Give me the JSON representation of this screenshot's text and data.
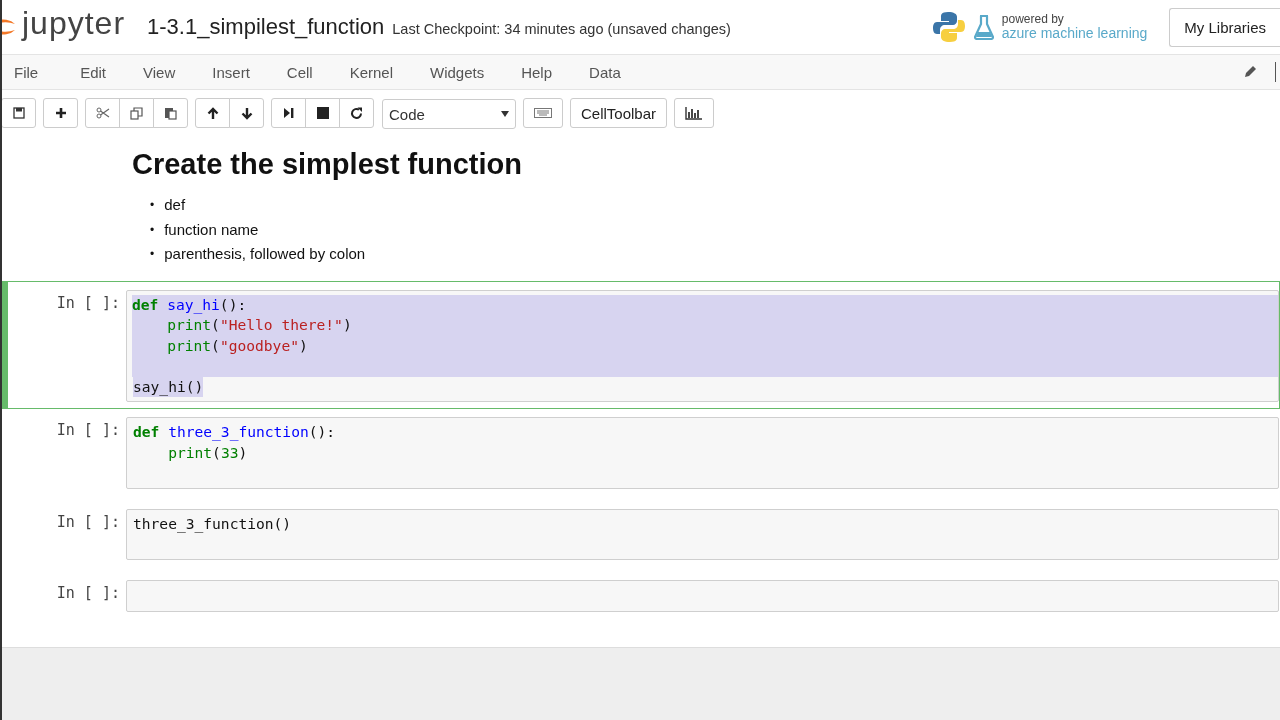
{
  "header": {
    "logo_text": "jupyter",
    "notebook_name": "1-3.1_simpilest_function",
    "checkpoint": "Last Checkpoint: 34 minutes ago (unsaved changes)",
    "powered_by": "powered by",
    "azure": "azure machine learning",
    "libraries_button": "My Libraries"
  },
  "menu": [
    "File",
    "Edit",
    "View",
    "Insert",
    "Cell",
    "Kernel",
    "Widgets",
    "Help",
    "Data"
  ],
  "toolbar": {
    "cell_type": "Code",
    "celltoolbar_button": "CellToolbar"
  },
  "markdown": {
    "heading": "Create the simplest function",
    "bullets": [
      {
        "marker": "•",
        "text": "def"
      },
      {
        "marker": "•",
        "text": "function name"
      },
      {
        "marker": "•",
        "text": "parenthesis, followed by colon"
      }
    ]
  },
  "cells": [
    {
      "prompt": "In [ ]:",
      "selected": true,
      "lines": [
        {
          "selected": true,
          "indented": false,
          "tokens": [
            {
              "kind": "keyword",
              "text": "def"
            },
            {
              "kind": "name",
              "text": "say_hi"
            },
            {
              "kind": "plain",
              "text": "():"
            }
          ]
        },
        {
          "selected": true,
          "indented": true,
          "tokens": [
            {
              "kind": "builtin",
              "text": "print"
            },
            {
              "kind": "plain",
              "text": "("
            },
            {
              "kind": "string",
              "text": "\"Hello there!\""
            },
            {
              "kind": "plain",
              "text": ")"
            }
          ]
        },
        {
          "selected": true,
          "indented": true,
          "tokens": [
            {
              "kind": "builtin",
              "text": "print"
            },
            {
              "kind": "plain",
              "text": "("
            },
            {
              "kind": "string",
              "text": "\"goodbye\""
            },
            {
              "kind": "plain",
              "text": ")"
            }
          ]
        },
        {
          "selected": true
        },
        {
          "selected": true,
          "indented": false,
          "tokens": [
            {
              "kind": "plain",
              "text": "say_hi()"
            }
          ]
        }
      ]
    },
    {
      "prompt": "In [ ]:",
      "selected": false,
      "lines": [
        {
          "selected": false,
          "indented": false,
          "tokens": [
            {
              "kind": "keyword",
              "text": "def"
            },
            {
              "kind": "name",
              "text": "three_3_function"
            },
            {
              "kind": "plain",
              "text": "():"
            }
          ]
        },
        {
          "selected": false,
          "indented": true,
          "tokens": [
            {
              "kind": "builtin",
              "text": "print"
            },
            {
              "kind": "plain",
              "text": "("
            },
            {
              "kind": "number",
              "text": "33"
            },
            {
              "kind": "plain",
              "text": ")"
            }
          ]
        },
        {
          "selected": false
        }
      ]
    },
    {
      "prompt": "In [ ]:",
      "selected": false,
      "lines": [
        {
          "selected": false,
          "indented": false,
          "tokens": [
            {
              "kind": "plain",
              "text": "three_3_function()"
            }
          ]
        },
        {
          "selected": false
        }
      ]
    },
    {
      "prompt": "In [ ]:",
      "selected": false,
      "lines": [
        {
          "selected": false
        }
      ]
    }
  ]
}
